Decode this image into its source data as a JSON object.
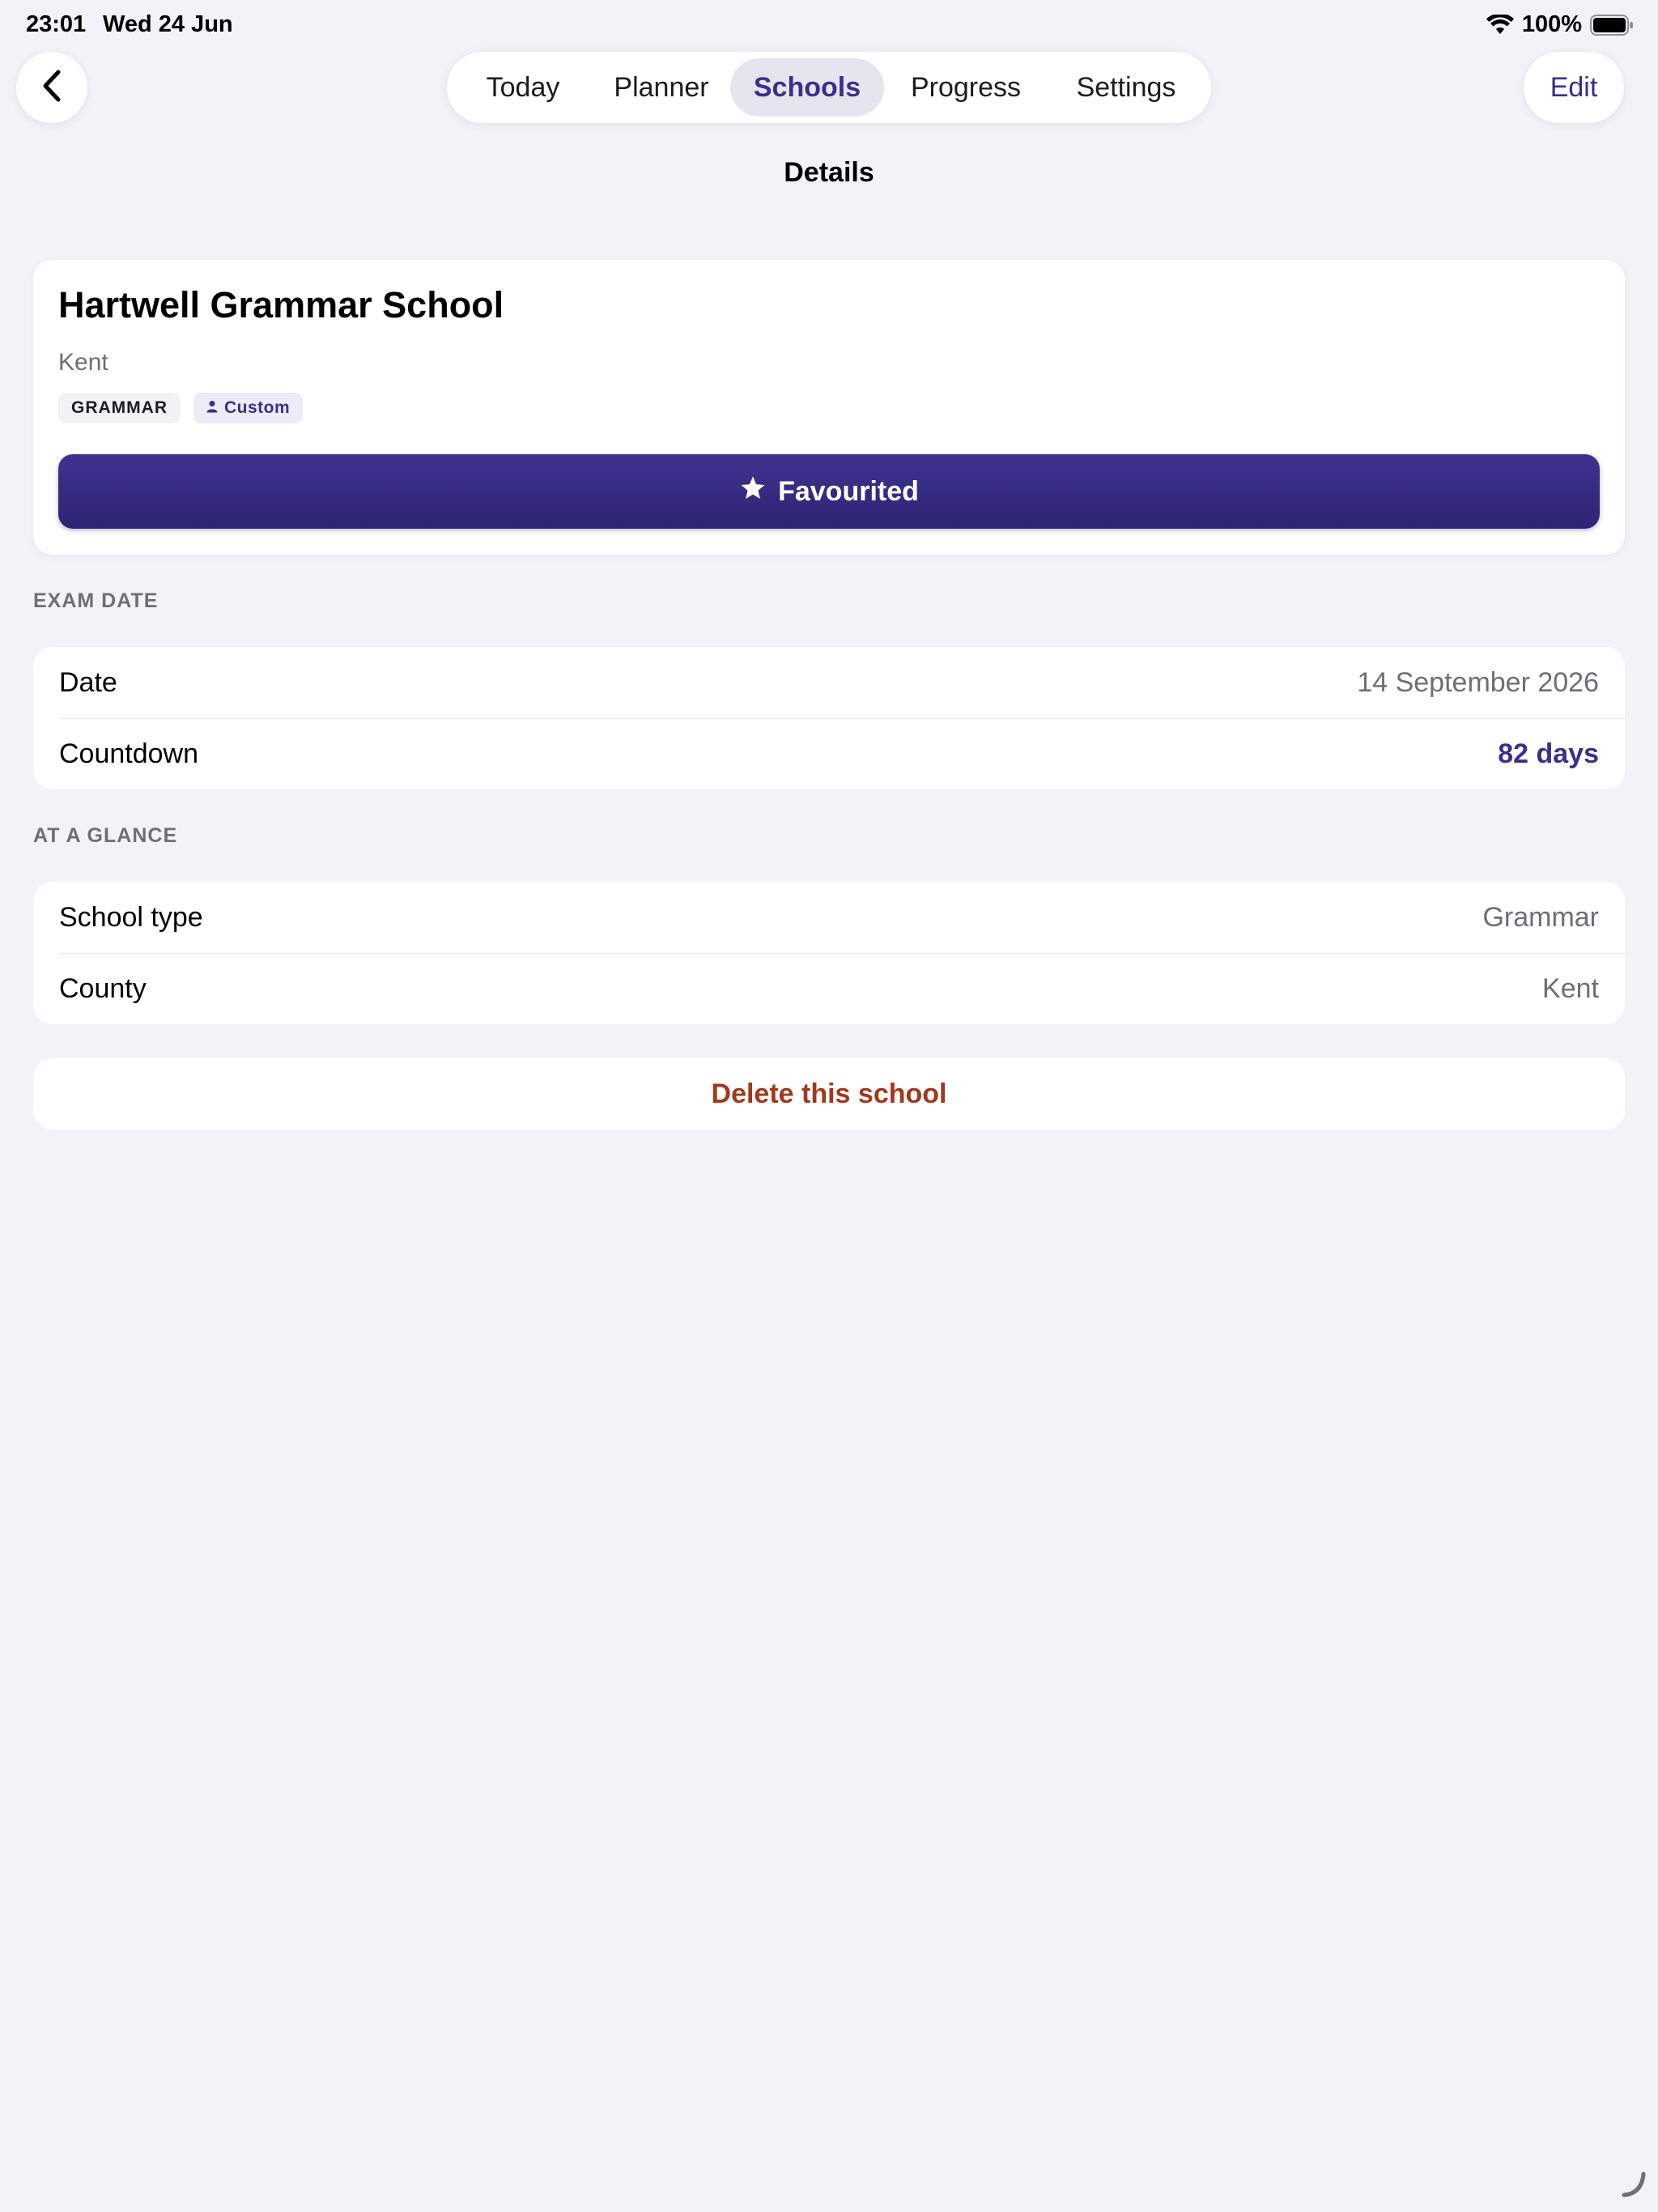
{
  "status_bar": {
    "time": "23:01",
    "date": "Wed 24 Jun",
    "battery": "100%"
  },
  "nav": {
    "tabs": [
      {
        "label": "Today"
      },
      {
        "label": "Planner"
      },
      {
        "label": "Schools",
        "active": true
      },
      {
        "label": "Progress"
      },
      {
        "label": "Settings"
      }
    ],
    "edit_label": "Edit",
    "title": "Details"
  },
  "school": {
    "name": "Hartwell Grammar School",
    "county": "Kent",
    "tags": [
      "GRAMMAR",
      "Custom"
    ],
    "favourite_label": "Favourited"
  },
  "exam_date": {
    "section_label": "EXAM DATE",
    "rows": [
      {
        "label": "Date",
        "value": "14 September 2026"
      },
      {
        "label": "Countdown",
        "value": "82 days"
      }
    ]
  },
  "at_a_glance": {
    "section_label": "AT A GLANCE",
    "rows": [
      {
        "label": "School type",
        "value": "Grammar"
      },
      {
        "label": "County",
        "value": "Kent"
      }
    ]
  },
  "delete_label": "Delete this school",
  "icons": {
    "back": "chevron-left-icon",
    "wifi": "wifi-icon",
    "battery": "battery-icon",
    "person": "person-icon",
    "star": "star-icon"
  },
  "colors": {
    "accent": "#3a2f8a",
    "button": "#2f2779",
    "destructive": "#a0391e",
    "background": "#f2f2f7"
  }
}
